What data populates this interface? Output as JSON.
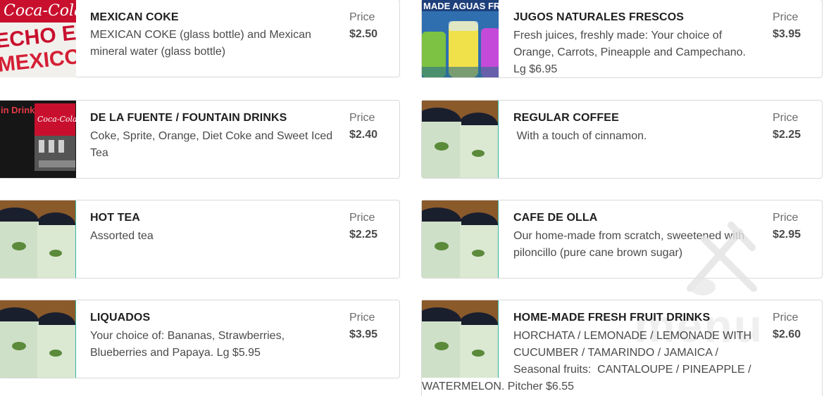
{
  "price_label": "Price",
  "items": [
    {
      "name": "MEXICAN COKE",
      "description": "MEXICAN COKE (glass bottle) and Mexican mineral water (glass bottle)",
      "price": "$2.50",
      "image": "coca-cola-mexico-image",
      "thumb_text_1": "Coca-Cola",
      "thumb_text_2": "ECHO E",
      "thumb_text_3": "MEXICO"
    },
    {
      "name": "JUGOS NATURALES FRESCOS",
      "description": "Fresh juices, freshly made: Your choice of Orange, Carrots, Pineapple and Campechano. Lg $6.95",
      "price": "$3.95",
      "image": "aguas-frescas-jars-image",
      "thumb_text_1": "MADE AGUAS FRE"
    },
    {
      "name": "DE LA FUENTE / FOUNTAIN DRINKS",
      "description": "Coke, Sprite, Orange, Diet Coke and Sweet Iced Tea",
      "price": "$2.40",
      "image": "fountain-machine-image",
      "thumb_text_1": "in Drinks",
      "thumb_text_2": "Coca-Cola"
    },
    {
      "name": "REGULAR COFFEE",
      "description": " With a touch of cinnamon.",
      "price": "$2.25",
      "image": "clay-mugs-image"
    },
    {
      "name": "HOT TEA",
      "description": "Assorted tea",
      "price": "$2.25",
      "image": "clay-mugs-image"
    },
    {
      "name": "CAFE DE OLLA",
      "description": "Our home-made from scratch, sweetened with piloncillo (pure cane brown sugar)",
      "price": "$2.95",
      "image": "clay-mugs-image"
    },
    {
      "name": "LIQUADOS",
      "description": "Your choice of: Bananas, Strawberries, Blueberries and Papaya. Lg $5.95",
      "price": "$3.95",
      "image": "clay-mugs-image"
    },
    {
      "name": "HOME-MADE FRESH FRUIT DRINKS",
      "description": "HORCHATA / LEMONADE / LEMONADE WITH CUCUMBER / TAMARINDO / JAMAICA / Seasonal fruits:  CANTALOUPE / PINEAPPLE / ",
      "description_tail": "WATERMELON. Pitcher $6.55",
      "price": "$2.60",
      "image": "clay-mugs-image"
    }
  ],
  "watermark": {
    "text": "menu",
    "icon": "fork-spoon-watermark-icon"
  },
  "colors": {
    "accent_teal": "#2fb5a5",
    "text_dark": "#1f1f1f",
    "text_muted": "#4a4a4a",
    "border": "#d9d9d9"
  }
}
